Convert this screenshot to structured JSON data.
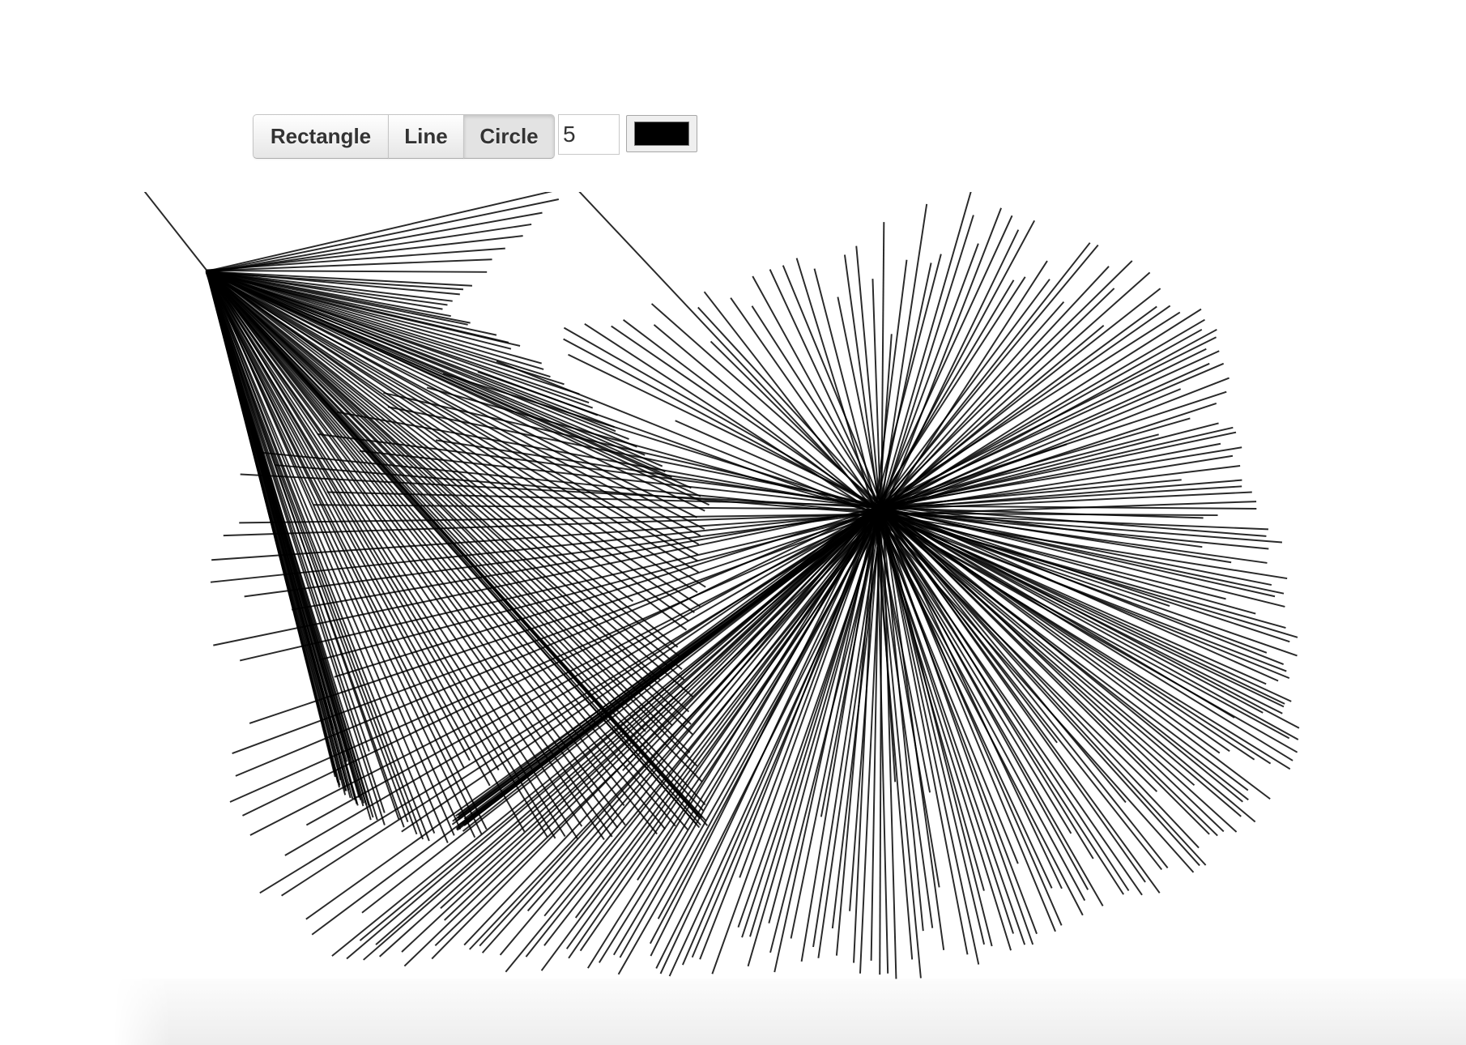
{
  "toolbar": {
    "tools": [
      {
        "label": "Rectangle",
        "active": false
      },
      {
        "label": "Line",
        "active": false
      },
      {
        "label": "Circle",
        "active": true
      }
    ],
    "line_width": "5",
    "stroke_color": "#000000"
  },
  "canvas": {
    "background": "#ffffff"
  }
}
